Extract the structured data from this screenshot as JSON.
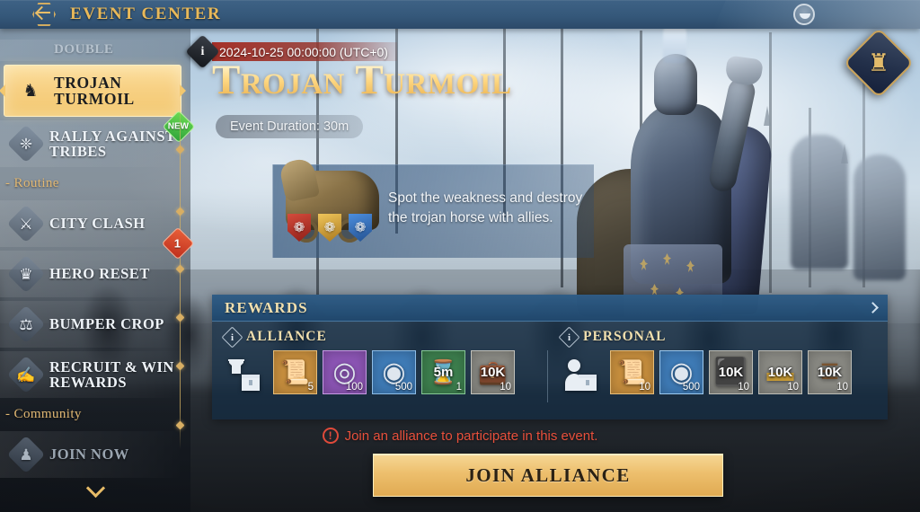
{
  "header": {
    "title": "EVENT CENTER",
    "back_icon": "back-arrow-icon",
    "settings_icon": "circle-toggle-icon",
    "trophy_icon": "trophy-icon",
    "trophy_glyph": "♜"
  },
  "sidebar": {
    "clipped_item_label": "DOUBLE",
    "more_icon": "chevron-down-icon",
    "items": [
      {
        "label": "TROJAN TURMOIL",
        "icon": "trojan-horse-icon",
        "glyph": "♞",
        "active": true,
        "badge": null
      },
      {
        "label": "RALLY AGAINST TRIBES",
        "icon": "shield-icon",
        "glyph": "❈",
        "active": false,
        "badge": "NEW",
        "badge_kind": "new"
      },
      {
        "label": "CITY CLASH",
        "icon": "city-icon",
        "glyph": "⚔",
        "active": false,
        "badge": null
      },
      {
        "label": "HERO RESET",
        "icon": "hero-crest-icon",
        "glyph": "♛",
        "active": false,
        "badge": "1",
        "badge_kind": "count"
      },
      {
        "label": "BUMPER CROP",
        "icon": "scales-icon",
        "glyph": "⚖",
        "active": false,
        "badge": null
      },
      {
        "label": "RECRUIT & WIN REWARDS",
        "icon": "scroll-quill-icon",
        "glyph": "✍",
        "active": false,
        "badge": null
      },
      {
        "label": "JOIN NOW",
        "icon": "people-icon",
        "glyph": "♟",
        "active": false,
        "badge": null,
        "dim": true
      }
    ],
    "groups": [
      {
        "label": "- Routine",
        "after_index": 1
      },
      {
        "label": "- Community",
        "after_index": 5
      }
    ]
  },
  "event": {
    "info_icon": "info-icon",
    "info_glyph": "i",
    "date": "2024-10-25 00:00:00 (UTC+0)",
    "title": "Trojan Turmoil",
    "duration": "Event Duration: 30m",
    "description": "Spot the weakness and destroy the trojan horse with allies.",
    "horse_icon": "trojan-horse-art",
    "shields": [
      {
        "name": "shield-red",
        "color": "#c0342b",
        "glyph": "❁"
      },
      {
        "name": "shield-gold",
        "color": "#d8a63c",
        "glyph": "❁"
      },
      {
        "name": "shield-blue",
        "color": "#3a74c4",
        "glyph": "❁"
      }
    ]
  },
  "rewards": {
    "section_title": "REWARDS",
    "expand_icon": "chevron-right-icon",
    "columns": [
      {
        "name": "alliance",
        "title": "ALLIANCE",
        "info_glyph": "i",
        "chest_icon": "alliance-chest-icon",
        "chest_glyph": "✉",
        "tiles": [
          {
            "name": "scroll-item",
            "art": "📜",
            "qty": "5",
            "big": "",
            "bg": "#c88f3e",
            "border": "#e7bd78"
          },
          {
            "name": "silver-medal-item",
            "art": "◎",
            "qty": "100",
            "big": "",
            "bg": "#8c55b5",
            "border": "#c79ae4"
          },
          {
            "name": "blue-token-item",
            "art": "◉",
            "qty": "500",
            "big": "",
            "bg": "#3f7cb8",
            "border": "#8dbce6"
          },
          {
            "name": "speedup-5m-item",
            "art": "⌛",
            "qty": "1",
            "big": "5m",
            "bg": "#3d7f4e",
            "border": "#86c896"
          },
          {
            "name": "chest-10k-item",
            "art": "💼",
            "qty": "10",
            "big": "10K",
            "bg": "#8a8a84",
            "border": "#c2c2bb"
          }
        ]
      },
      {
        "name": "personal",
        "title": "PERSONAL",
        "info_glyph": "i",
        "chest_icon": "personal-chest-icon",
        "chest_glyph": "✉",
        "tiles": [
          {
            "name": "scroll-item",
            "art": "📜",
            "qty": "10",
            "big": "",
            "bg": "#c88f3e",
            "border": "#e7bd78"
          },
          {
            "name": "blue-token-item",
            "art": "◉",
            "qty": "500",
            "big": "",
            "bg": "#3f7cb8",
            "border": "#9cc9ef"
          },
          {
            "name": "stone-10k-item",
            "art": "⬛",
            "qty": "10",
            "big": "10K",
            "bg": "#8a8a84",
            "border": "#bdbdb6"
          },
          {
            "name": "gold-10k-item",
            "art": "▬",
            "qty": "10",
            "big": "10K",
            "bg": "#8a8a84",
            "border": "#bdbdb6"
          },
          {
            "name": "wood-10k-item",
            "art": "☰",
            "qty": "10",
            "big": "10K",
            "bg": "#8a8a84",
            "border": "#bdbdb6"
          }
        ]
      }
    ]
  },
  "footer": {
    "warning_icon": "alert-icon",
    "warning_glyph": "!",
    "warning_text": "Join an alliance to participate in this event.",
    "cta_label": "JOIN ALLIANCE"
  }
}
